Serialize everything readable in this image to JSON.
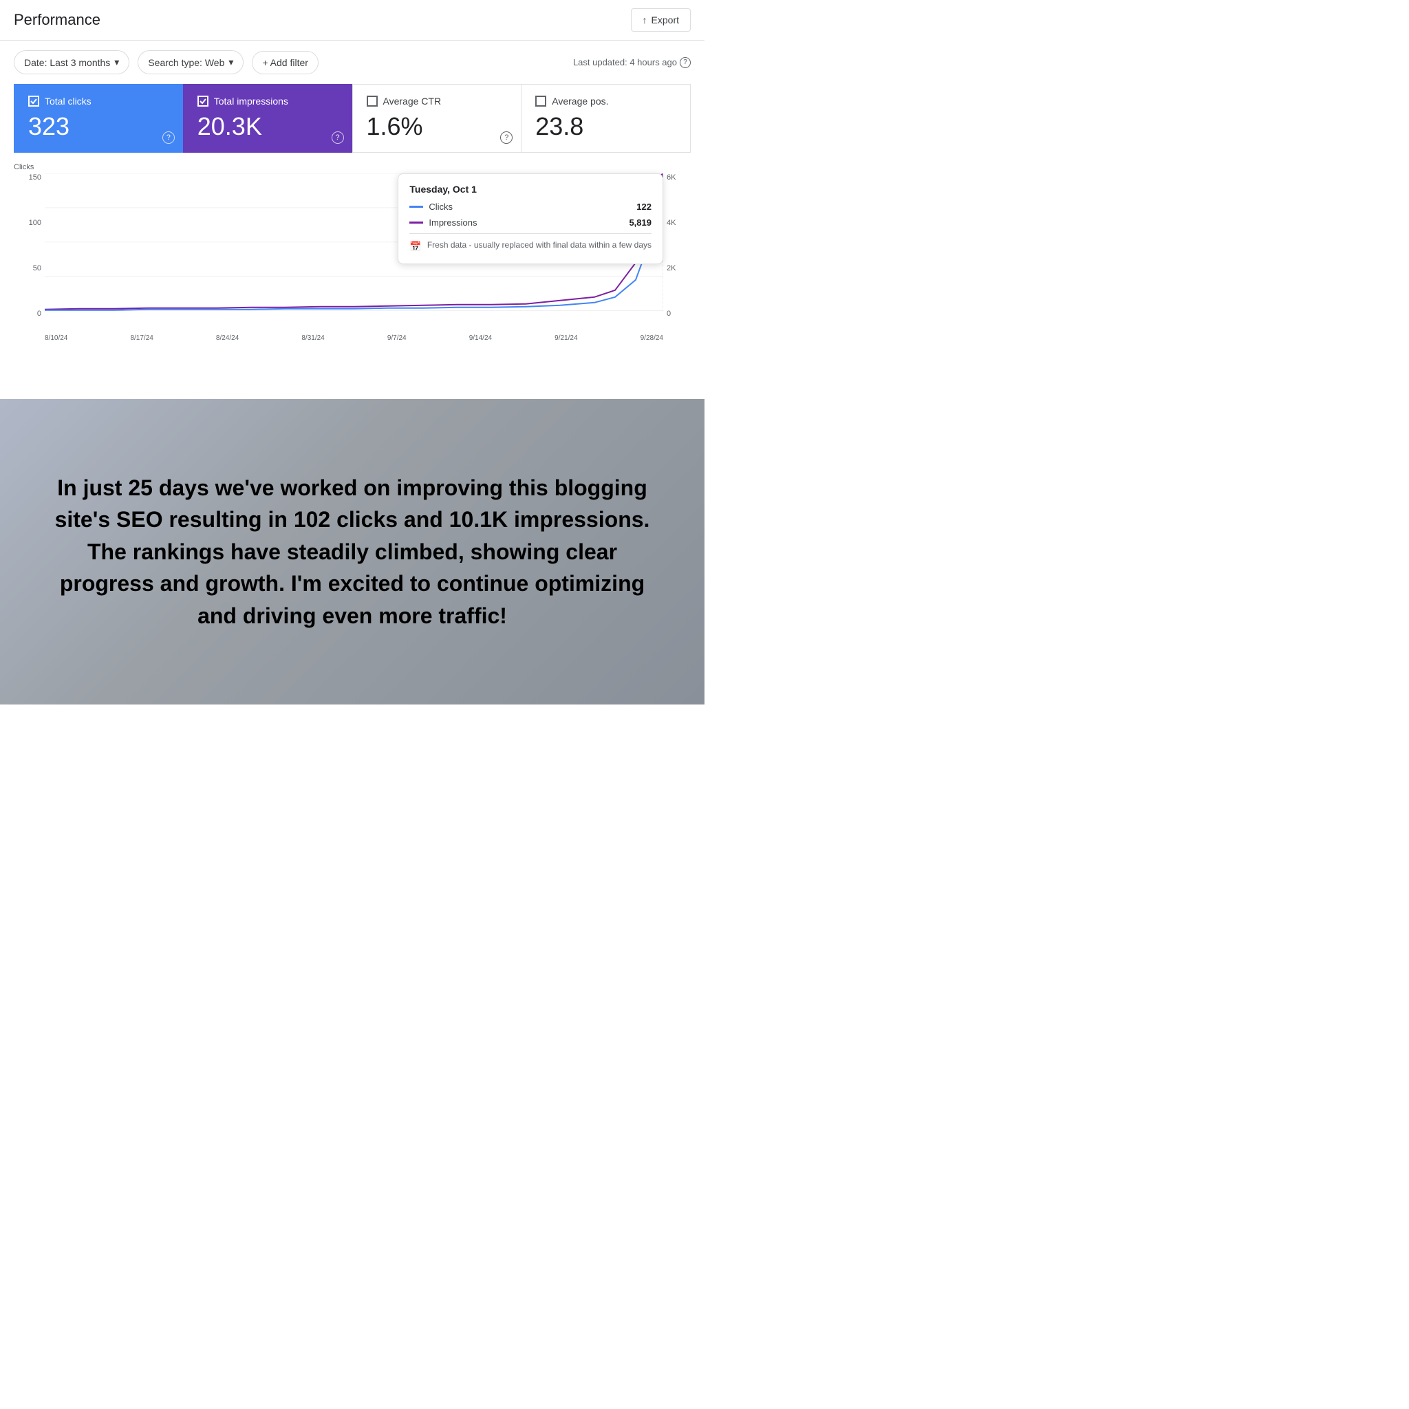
{
  "header": {
    "title": "Performance",
    "export_label": "Export"
  },
  "filters": {
    "date_label": "Date: Last 3 months",
    "search_type_label": "Search type: Web",
    "add_filter_label": "+ Add filter",
    "last_updated": "Last updated: 4 hours ago"
  },
  "metrics": [
    {
      "id": "total-clicks",
      "label": "Total clicks",
      "value": "323",
      "active": true,
      "color": "blue"
    },
    {
      "id": "total-impressions",
      "label": "Total impressions",
      "value": "20.3K",
      "active": true,
      "color": "purple"
    },
    {
      "id": "average-ctr",
      "label": "Average CTR",
      "value": "1.6%",
      "active": false,
      "color": "none"
    },
    {
      "id": "average-position",
      "label": "Average pos.",
      "value": "23.8",
      "active": false,
      "color": "none"
    }
  ],
  "chart": {
    "y_axis_left_label": "Clicks",
    "y_axis_left_values": [
      "150",
      "100",
      "50",
      "0"
    ],
    "y_axis_right_values": [
      "6K",
      "4K",
      "2K",
      "0"
    ],
    "x_axis_dates": [
      "8/10/24",
      "8/17/24",
      "8/24/24",
      "8/31/24",
      "9/7/24",
      "9/14/24",
      "9/21/24",
      "9/28/24"
    ]
  },
  "tooltip": {
    "date": "Tuesday, Oct 1",
    "clicks_label": "Clicks",
    "clicks_value": "122",
    "impressions_label": "Impressions",
    "impressions_value": "5,819",
    "fresh_data_text": "Fresh data - usually replaced with final data within a few days"
  },
  "bottom": {
    "text": "In just 25 days we've worked on improving this blogging site's SEO resulting in 102 clicks and 10.1K impressions. The rankings have steadily climbed, showing clear progress and growth. I'm excited to continue optimizing and driving even more traffic!"
  }
}
